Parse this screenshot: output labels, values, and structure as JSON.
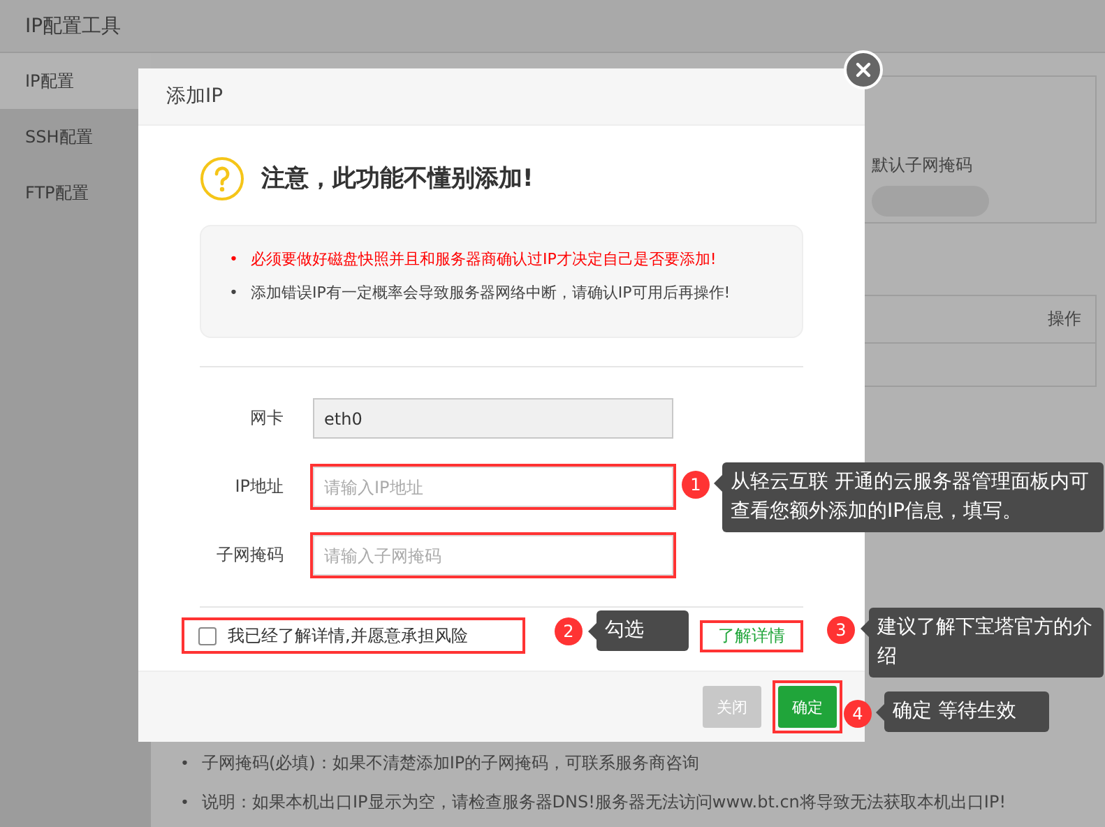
{
  "app": {
    "title": "IP配置工具",
    "sidebar": [
      {
        "label": "IP配置",
        "selected": true
      },
      {
        "label": "SSH配置",
        "selected": false
      },
      {
        "label": "FTP配置",
        "selected": false
      }
    ],
    "card": {
      "label": "默认子网掩码"
    },
    "table": {
      "columns": [
        "操作"
      ]
    },
    "notes": [
      {
        "bullet": "•",
        "text": "子网掩码(必填)：如果不清楚添加IP的子网掩码，可联系服务商咨询"
      },
      {
        "bullet": "•",
        "text": "说明：如果本机出口IP显示为空，请检查服务器DNS!服务器无法访问www.bt.cn将导致无法获取本机出口IP!"
      }
    ]
  },
  "dialog": {
    "title": "添加IP",
    "heading": "注意，此功能不懂别添加!",
    "warnings": [
      {
        "bullet": "•",
        "text": "必须要做好磁盘快照并且和服务器商确认过IP才决定自己是否要添加!",
        "kind": "danger"
      },
      {
        "bullet": "•",
        "text": "添加错误IP有一定概率会导致服务器网络中断，请确认IP可用后再操作!",
        "kind": "normal"
      }
    ],
    "fields": [
      {
        "label": "网卡",
        "value": "eth0",
        "disabled": true,
        "highlighted": false
      },
      {
        "label": "IP地址",
        "placeholder": "请输入IP地址",
        "disabled": false,
        "highlighted": true
      },
      {
        "label": "子网掩码",
        "placeholder": "请输入子网掩码",
        "disabled": false,
        "highlighted": true
      }
    ],
    "agree": {
      "label": "我已经了解详情,并愿意承担风险",
      "checked": false,
      "highlighted": true
    },
    "link": {
      "label": "了解详情",
      "highlighted": true
    },
    "buttons": [
      {
        "label": "关闭",
        "kind": "secondary",
        "highlighted": false
      },
      {
        "label": "确定",
        "kind": "primary",
        "highlighted": true
      }
    ]
  },
  "annotations": [
    {
      "number": "1",
      "text": "从轻云互联 开通的云服务器管理面板内可查看您额外添加的IP信息，填写。"
    },
    {
      "number": "2",
      "text": "勾选"
    },
    {
      "number": "3",
      "text": "建议了解下宝塔官方的介绍"
    },
    {
      "number": "4",
      "text": "确定 等待生效"
    }
  ]
}
